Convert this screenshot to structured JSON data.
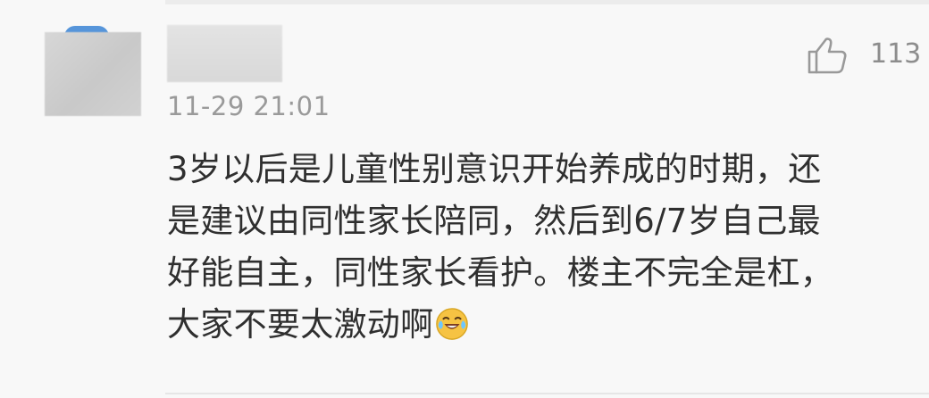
{
  "comment": {
    "timestamp": "11-29 21:01",
    "likes": {
      "count": "113",
      "icon": "thumb-up-icon"
    },
    "content_lines": [
      "3岁以后是儿童性别意识开始养成的时期，还",
      "是建议由同性家长陪同，然后到6/7岁自己最",
      "好能自主，同性家长看护。楼主不完全是杠，",
      "大家不要太激动啊"
    ],
    "emoji": "laughing-crying-emoji"
  },
  "colors": {
    "background": "#f8f8f8",
    "text": "#2f2f2f",
    "secondary_text": "#9a9a9a",
    "accent": "#4d8fd8",
    "emoji": "#f6c343"
  }
}
